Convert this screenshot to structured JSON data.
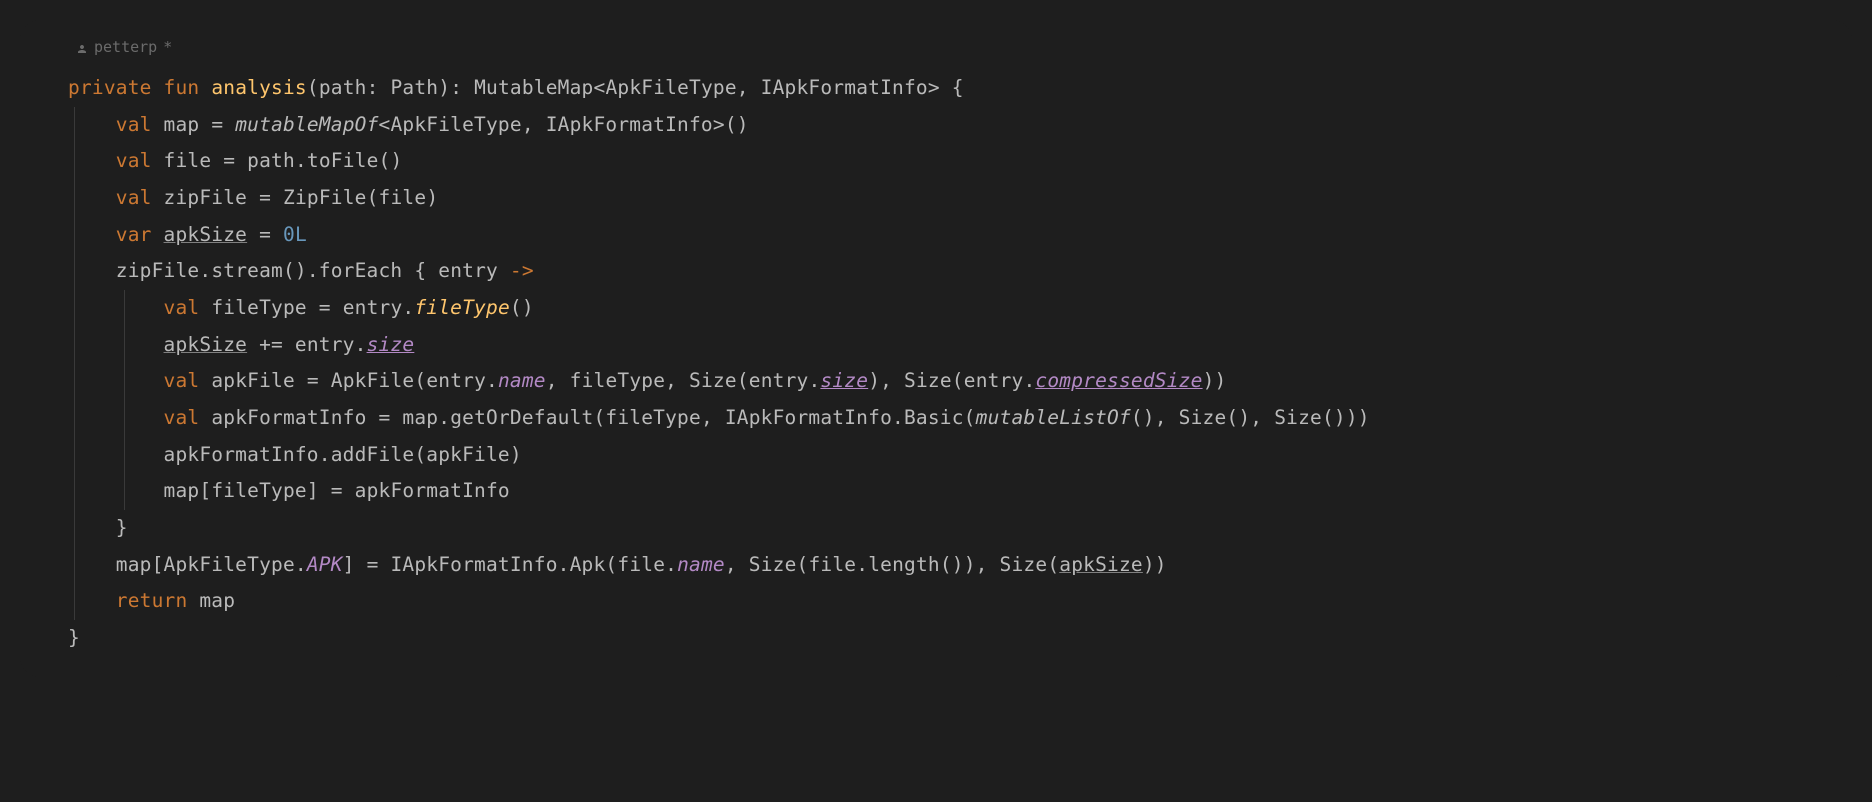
{
  "author": {
    "name": "petterp",
    "modified": "*"
  },
  "code": {
    "l1": {
      "private": "private",
      "fun": "fun",
      "analysis": "analysis",
      "path": "path",
      "Path": "Path",
      "MutableMap": "MutableMap",
      "ApkFileType": "ApkFileType",
      "IApkFormatInfo": "IApkFormatInfo",
      "brace": "{"
    },
    "l2": {
      "val": "val",
      "map": "map",
      "eq": "=",
      "mutableMapOf": "mutableMapOf",
      "ApkFileType": "ApkFileType",
      "IApkFormatInfo": "IApkFormatInfo",
      "parens": "()"
    },
    "l3": {
      "val": "val",
      "file": "file",
      "eq": "=",
      "path": "path",
      "toFile": "toFile",
      "parens": "()"
    },
    "l4": {
      "val": "val",
      "zipFile": "zipFile",
      "eq": "=",
      "ZipFile": "ZipFile",
      "file": "file"
    },
    "l5": {
      "var": "var",
      "apkSize": "apkSize",
      "eq": "=",
      "zero": "0L"
    },
    "l6": {
      "zipFile": "zipFile",
      "stream": "stream",
      "forEach": "forEach",
      "entry": "entry",
      "arrow": "->",
      "brace": "{"
    },
    "l7": {
      "val": "val",
      "fileType": "fileType",
      "eq": "=",
      "entry": "entry",
      "fileTypeFn": "fileType",
      "parens": "()"
    },
    "l8": {
      "apkSize": "apkSize",
      "pluseq": "+=",
      "entry": "entry",
      "size": "size"
    },
    "l9": {
      "val": "val",
      "apkFile": "apkFile",
      "eq": "=",
      "ApkFile": "ApkFile",
      "entry": "entry",
      "name": "name",
      "fileType": "fileType",
      "Size": "Size",
      "size": "size",
      "compressedSize": "compressedSize"
    },
    "l10": {
      "val": "val",
      "apkFormatInfo": "apkFormatInfo",
      "eq": "=",
      "map": "map",
      "getOrDefault": "getOrDefault",
      "fileType": "fileType",
      "IApkFormatInfo": "IApkFormatInfo",
      "Basic": "Basic",
      "mutableListOf": "mutableListOf",
      "Size": "Size"
    },
    "l11": {
      "apkFormatInfo": "apkFormatInfo",
      "addFile": "addFile",
      "apkFile": "apkFile"
    },
    "l12": {
      "map": "map",
      "fileType": "fileType",
      "eq": "=",
      "apkFormatInfo": "apkFormatInfo"
    },
    "l13": {
      "brace": "}"
    },
    "l14": {
      "map": "map",
      "ApkFileType": "ApkFileType",
      "APK": "APK",
      "eq": "=",
      "IApkFormatInfo": "IApkFormatInfo",
      "Apk": "Apk",
      "file": "file",
      "name": "name",
      "Size": "Size",
      "length": "length",
      "apkSize": "apkSize"
    },
    "l15": {
      "return": "return",
      "map": "map"
    },
    "l16": {
      "brace": "}"
    }
  }
}
